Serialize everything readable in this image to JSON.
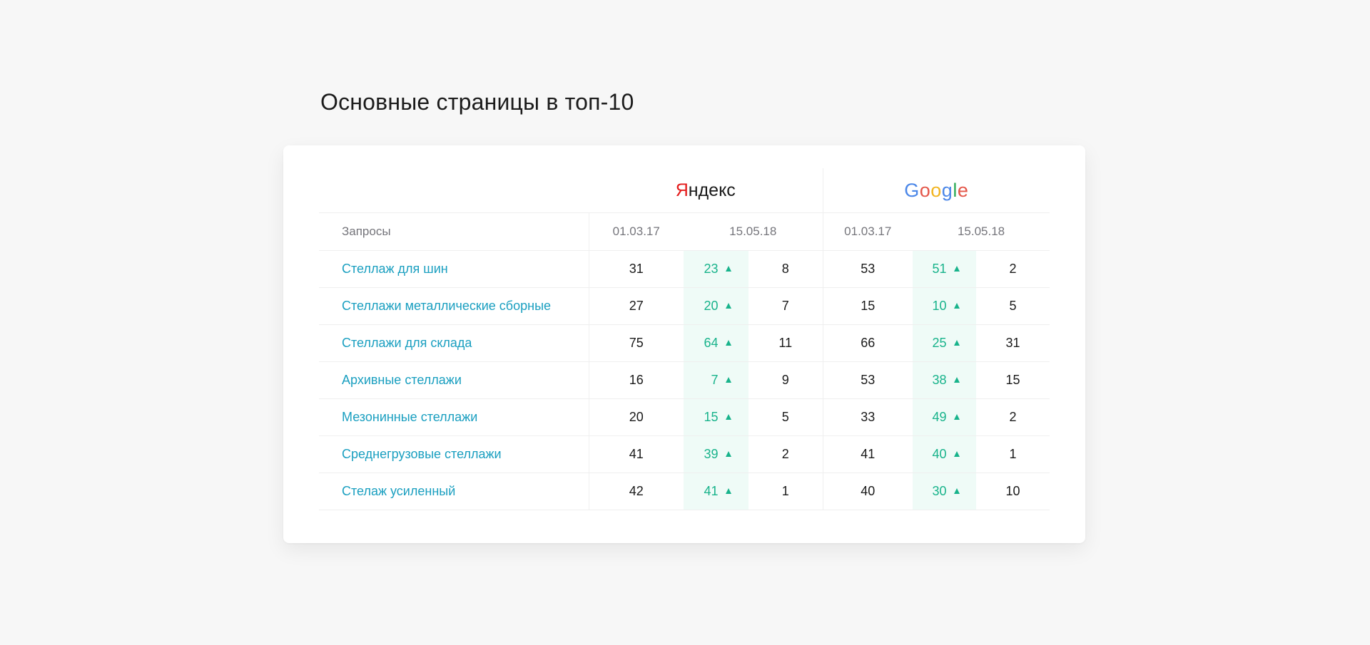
{
  "page": {
    "title": "Основные страницы в топ-10"
  },
  "engines": {
    "yandex": {
      "logo_first_letter": "Я",
      "logo_rest": "ндекс",
      "brand_color": "#e41c1c"
    },
    "google": {
      "letters": [
        "G",
        "o",
        "o",
        "g",
        "l",
        "e"
      ],
      "colors": [
        "#4b87e8",
        "#e4574a",
        "#f2b521",
        "#4b87e8",
        "#2fab58",
        "#e4574a"
      ]
    }
  },
  "table": {
    "header": {
      "queries_label": "Запросы",
      "yandex_date_start": "01.03.17",
      "yandex_date_end": "15.05.18",
      "google_date_start": "01.03.17",
      "google_date_end": "15.05.18"
    },
    "rows": [
      {
        "query": "Стеллаж для шин",
        "y_start": "31",
        "y_end": "23",
        "y_change": "8",
        "g_start": "53",
        "g_end": "51",
        "g_change": "2"
      },
      {
        "query": "Стеллажи металлические сборные",
        "y_start": "27",
        "y_end": "20",
        "y_change": "7",
        "g_start": "15",
        "g_end": "10",
        "g_change": "5"
      },
      {
        "query": "Стеллажи для склада",
        "y_start": "75",
        "y_end": "64",
        "y_change": "11",
        "g_start": "66",
        "g_end": "25",
        "g_change": "31"
      },
      {
        "query": "Архивные стеллажи",
        "y_start": "16",
        "y_end": "7",
        "y_change": "9",
        "g_start": "53",
        "g_end": "38",
        "g_change": "15"
      },
      {
        "query": "Мезонинные стеллажи",
        "y_start": "20",
        "y_end": "15",
        "y_change": "5",
        "g_start": "33",
        "g_end": "49",
        "g_change": "2"
      },
      {
        "query": "Среднегрузовые стеллажи",
        "y_start": "41",
        "y_end": "39",
        "y_change": "2",
        "g_start": "41",
        "g_end": "40",
        "g_change": "1"
      },
      {
        "query": "Стелаж усиленный",
        "y_start": "42",
        "y_end": "41",
        "y_change": "1",
        "g_start": "40",
        "g_end": "30",
        "g_change": "10"
      }
    ]
  },
  "colors": {
    "link": "#1a9fc0",
    "positive": "#18b38b",
    "highlight_bg": "#effbf7"
  },
  "icons": {
    "trend": "triangle-up-icon"
  }
}
